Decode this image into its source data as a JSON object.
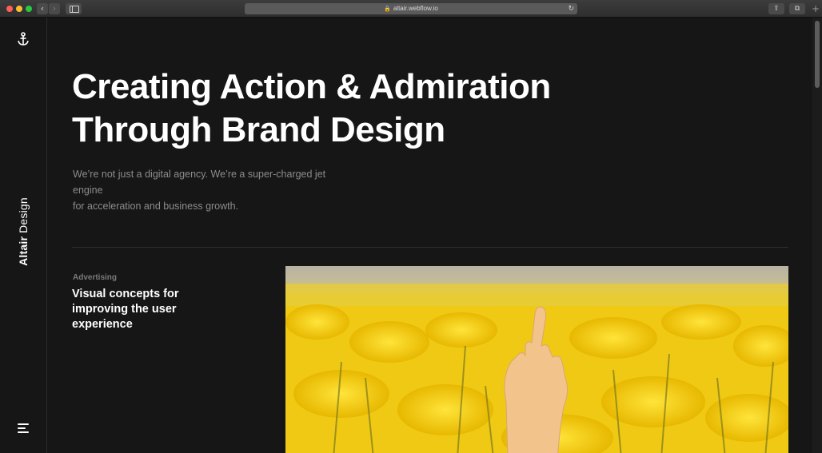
{
  "browser": {
    "url": "altair.webflow.io",
    "back_glyph": "‹",
    "forward_glyph": "›",
    "reload_glyph": "↻",
    "share_glyph": "⇪",
    "tabs_glyph": "⧉",
    "newtab_glyph": "+"
  },
  "sidebar": {
    "brand_bold": "Altair",
    "brand_light": "Design",
    "logo_icon": "anchor-icon",
    "menu_icon": "hamburger-menu-icon"
  },
  "hero": {
    "headline_line1": "Creating Action & Admiration",
    "headline_line2": "Through Brand Design",
    "lead_line1": "We’re not just a digital agency. We’re a super-charged jet engine",
    "lead_line2": "for acceleration and business growth."
  },
  "feature": {
    "eyebrow": "Advertising",
    "title_line1": "Visual concepts for",
    "title_line2": "improving the user",
    "title_line3": "experience",
    "image": "hand-in-yellow-flower-field"
  },
  "colors": {
    "background": "#161616",
    "text": "#ffffff",
    "muted": "#8c8c8c",
    "accent_yellow": "#f2cf12"
  }
}
